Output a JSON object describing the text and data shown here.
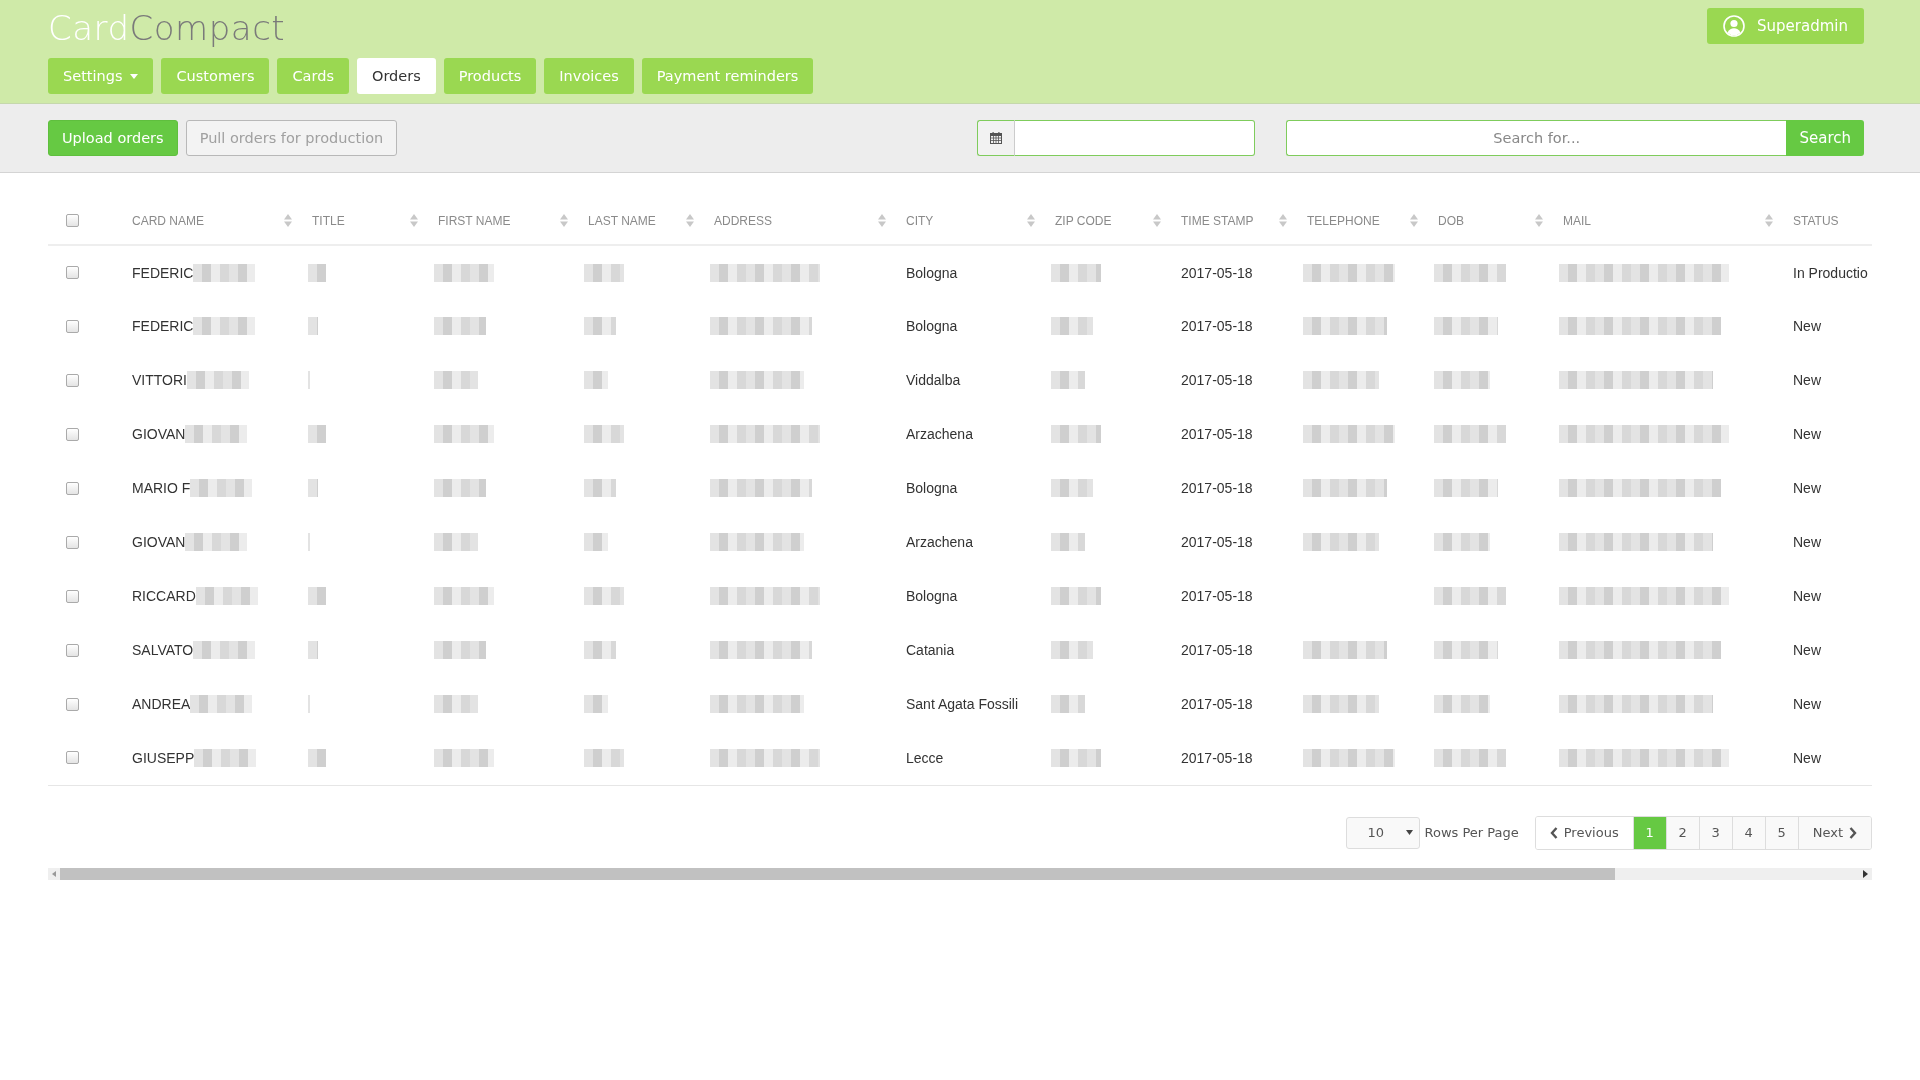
{
  "logo": {
    "parts": [
      {
        "text": "Card",
        "kind": "light"
      },
      {
        "text": "Compact",
        "kind": "dark"
      }
    ]
  },
  "user_button": {
    "label": "Superadmin"
  },
  "nav": [
    {
      "label": "Settings",
      "dropdown": true,
      "selected": false
    },
    {
      "label": "Customers",
      "dropdown": false,
      "selected": false
    },
    {
      "label": "Cards",
      "dropdown": false,
      "selected": false
    },
    {
      "label": "Orders",
      "dropdown": false,
      "selected": true
    },
    {
      "label": "Products",
      "dropdown": false,
      "selected": false
    },
    {
      "label": "Invoices",
      "dropdown": false,
      "selected": false
    },
    {
      "label": "Payment reminders",
      "dropdown": false,
      "selected": false
    }
  ],
  "toolbar": {
    "buttons": [
      {
        "label": "Upload orders",
        "disabled": false
      },
      {
        "label": "Pull orders for production",
        "disabled": true
      }
    ],
    "search": {
      "placeholder": "Search for...",
      "button": "Search"
    }
  },
  "table": {
    "select_all": {
      "checked": false
    },
    "columns": [
      {
        "label": "CARD NAME",
        "sortable": true
      },
      {
        "label": "TITLE",
        "sortable": true
      },
      {
        "label": "FIRST NAME",
        "sortable": true
      },
      {
        "label": "LAST NAME",
        "sortable": true
      },
      {
        "label": "ADDRESS",
        "sortable": true
      },
      {
        "label": "CITY",
        "sortable": true
      },
      {
        "label": "ZIP CODE",
        "sortable": true
      },
      {
        "label": "TIME STAMP",
        "sortable": true
      },
      {
        "label": "TELEPHONE",
        "sortable": true
      },
      {
        "label": "DOB",
        "sortable": true
      },
      {
        "label": "MAIL",
        "sortable": true
      },
      {
        "label": "STATUS",
        "sortable": false
      }
    ],
    "rows": [
      {
        "checked": false,
        "cells": [
          {
            "text": "FEDERIC",
            "redacted": true
          },
          {
            "redacted": true
          },
          {
            "redacted": true
          },
          {
            "redacted": true
          },
          {
            "redacted": true
          },
          {
            "text": "Bologna",
            "redacted": false
          },
          {
            "redacted": true
          },
          {
            "text": "2017-05-18",
            "redacted": false
          },
          {
            "redacted": true
          },
          {
            "redacted": true
          },
          {
            "redacted": true
          },
          {
            "text": "In Productio",
            "redacted": false
          }
        ]
      },
      {
        "checked": false,
        "cells": [
          {
            "text": "FEDERIC",
            "redacted": true
          },
          {
            "redacted": true
          },
          {
            "redacted": true
          },
          {
            "redacted": true
          },
          {
            "redacted": true
          },
          {
            "text": "Bologna",
            "redacted": false
          },
          {
            "redacted": true
          },
          {
            "text": "2017-05-18",
            "redacted": false
          },
          {
            "redacted": true
          },
          {
            "redacted": true
          },
          {
            "redacted": true
          },
          {
            "text": "New",
            "redacted": false
          }
        ]
      },
      {
        "checked": false,
        "cells": [
          {
            "text": "VITTORI",
            "redacted": true
          },
          {
            "redacted": true
          },
          {
            "redacted": true
          },
          {
            "redacted": true
          },
          {
            "redacted": true
          },
          {
            "text": "Viddalba",
            "redacted": false
          },
          {
            "redacted": true
          },
          {
            "text": "2017-05-18",
            "redacted": false
          },
          {
            "redacted": true
          },
          {
            "redacted": true
          },
          {
            "redacted": true
          },
          {
            "text": "New",
            "redacted": false
          }
        ]
      },
      {
        "checked": false,
        "cells": [
          {
            "text": "GIOVAN",
            "redacted": true
          },
          {
            "redacted": true
          },
          {
            "redacted": true
          },
          {
            "redacted": true
          },
          {
            "redacted": true
          },
          {
            "text": "Arzachena",
            "redacted": false
          },
          {
            "redacted": true
          },
          {
            "text": "2017-05-18",
            "redacted": false
          },
          {
            "redacted": true
          },
          {
            "redacted": true
          },
          {
            "redacted": true
          },
          {
            "text": "New",
            "redacted": false
          }
        ]
      },
      {
        "checked": false,
        "cells": [
          {
            "text": "MARIO F",
            "redacted": true
          },
          {
            "redacted": true
          },
          {
            "redacted": true
          },
          {
            "redacted": true
          },
          {
            "redacted": true
          },
          {
            "text": "Bologna",
            "redacted": false
          },
          {
            "redacted": true
          },
          {
            "text": "2017-05-18",
            "redacted": false
          },
          {
            "redacted": true
          },
          {
            "redacted": true
          },
          {
            "redacted": true
          },
          {
            "text": "New",
            "redacted": false
          }
        ]
      },
      {
        "checked": false,
        "cells": [
          {
            "text": "GIOVAN",
            "redacted": true
          },
          {
            "redacted": true
          },
          {
            "redacted": true
          },
          {
            "redacted": true
          },
          {
            "redacted": true
          },
          {
            "text": "Arzachena",
            "redacted": false
          },
          {
            "redacted": true
          },
          {
            "text": "2017-05-18",
            "redacted": false
          },
          {
            "redacted": true
          },
          {
            "redacted": true
          },
          {
            "redacted": true
          },
          {
            "text": "New",
            "redacted": false
          }
        ]
      },
      {
        "checked": false,
        "cells": [
          {
            "text": "RICCARD",
            "redacted": true
          },
          {
            "redacted": true
          },
          {
            "redacted": true
          },
          {
            "redacted": true
          },
          {
            "redacted": true
          },
          {
            "text": "Bologna",
            "redacted": false
          },
          {
            "redacted": true
          },
          {
            "text": "2017-05-18",
            "redacted": false
          },
          {
            "redacted": false
          },
          {
            "redacted": true
          },
          {
            "redacted": true
          },
          {
            "text": "New",
            "redacted": false
          }
        ]
      },
      {
        "checked": false,
        "cells": [
          {
            "text": "SALVATO",
            "redacted": true
          },
          {
            "redacted": true
          },
          {
            "redacted": true
          },
          {
            "redacted": true
          },
          {
            "redacted": true
          },
          {
            "text": "Catania",
            "redacted": false
          },
          {
            "redacted": true
          },
          {
            "text": "2017-05-18",
            "redacted": false
          },
          {
            "redacted": true
          },
          {
            "redacted": true
          },
          {
            "redacted": true
          },
          {
            "text": "New",
            "redacted": false
          }
        ]
      },
      {
        "checked": false,
        "cells": [
          {
            "text": "ANDREA",
            "redacted": true
          },
          {
            "redacted": true
          },
          {
            "redacted": true
          },
          {
            "redacted": true
          },
          {
            "redacted": true
          },
          {
            "text": "Sant Agata Fossili",
            "redacted": false
          },
          {
            "redacted": true
          },
          {
            "text": "2017-05-18",
            "redacted": false
          },
          {
            "redacted": true
          },
          {
            "redacted": true
          },
          {
            "redacted": true
          },
          {
            "text": "New",
            "redacted": false
          }
        ]
      },
      {
        "checked": false,
        "cells": [
          {
            "text": "GIUSEPP",
            "redacted": true
          },
          {
            "redacted": true
          },
          {
            "redacted": true
          },
          {
            "redacted": true
          },
          {
            "redacted": true
          },
          {
            "text": "Lecce",
            "redacted": false
          },
          {
            "redacted": true
          },
          {
            "text": "2017-05-18",
            "redacted": false
          },
          {
            "redacted": true
          },
          {
            "redacted": true
          },
          {
            "redacted": true
          },
          {
            "text": "New",
            "redacted": false
          }
        ]
      }
    ]
  },
  "footer": {
    "page_size": {
      "value": "10"
    },
    "page_size_label": "Rows Per Page",
    "previous": "Previous",
    "next": "Next",
    "pages": [
      {
        "label": "1",
        "selected": true
      },
      {
        "label": "2",
        "selected": false
      },
      {
        "label": "3",
        "selected": false
      },
      {
        "label": "4",
        "selected": false
      },
      {
        "label": "5",
        "selected": false
      }
    ]
  }
}
